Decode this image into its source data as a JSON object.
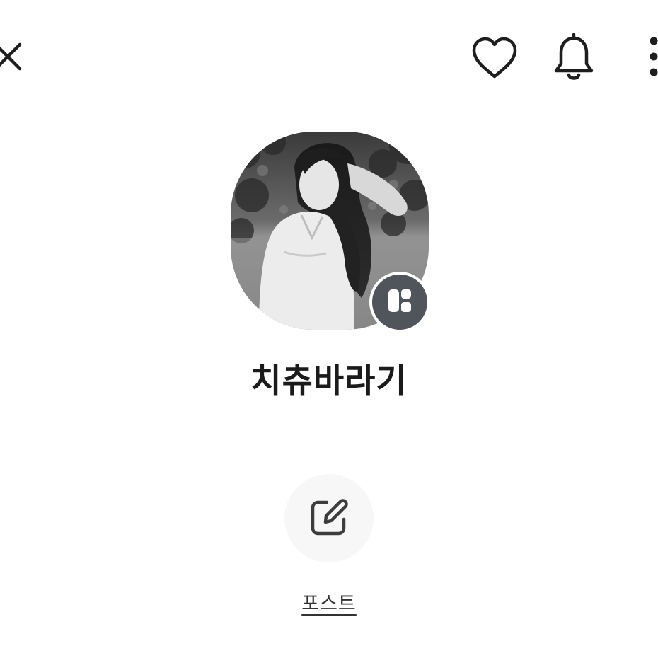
{
  "header": {
    "icons": {
      "close": "close-icon",
      "heart": "heart-icon",
      "bell": "bell-icon",
      "more": "more-vertical-icon"
    }
  },
  "profile": {
    "name": "치츄바라기",
    "avatar_description_icon": "profile-photo",
    "badge_icon": "kakao-view-icon",
    "badge_color": "#50555c"
  },
  "actions": {
    "post": {
      "label": "포스트",
      "icon": "edit-icon",
      "circle_color": "#f7f7f7"
    }
  }
}
